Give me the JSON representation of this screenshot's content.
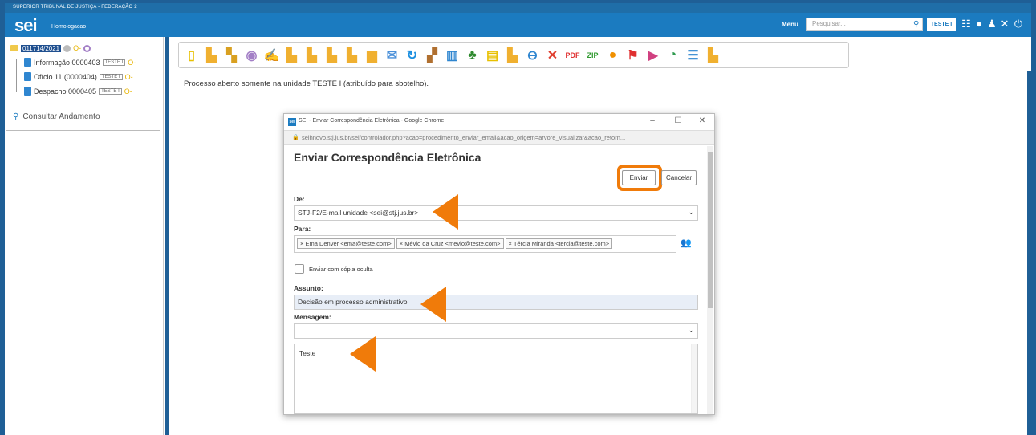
{
  "app": {
    "banner": "SUPERIOR TRIBUNAL DE JUSTIÇA - FEDERAÇÃO 2",
    "logo": "sei",
    "environment": "Homologacao",
    "menu_label": "Menu",
    "search_placeholder": "Pesquisar...",
    "unit": "TESTE I"
  },
  "tree": {
    "process_number": "011714/2021",
    "docs": [
      {
        "label": "Informação 0000403",
        "tag": "TESTE I"
      },
      {
        "label": "Ofício 11 (0000404)",
        "tag": "TESTE I"
      },
      {
        "label": "Despacho 0000405",
        "tag": "TESTE I"
      }
    ],
    "consult_label": "Consultar Andamento"
  },
  "toolbar": {
    "icons": [
      "new-document",
      "follow-process",
      "process-settings",
      "view",
      "sign",
      "send",
      "info",
      "relate",
      "attach",
      "pending",
      "email",
      "refresh",
      "sobrestar",
      "statistics",
      "region-map",
      "notes",
      "pause",
      "link",
      "remove",
      "pdf",
      "zip",
      "comment",
      "flag",
      "marker",
      "deadline",
      "list",
      "search"
    ]
  },
  "main": {
    "info_text": "Processo aberto somente na unidade TESTE I (atribuído para sbotelho)."
  },
  "popup": {
    "window_title": "SEI - Enviar Correspondência Eletrônica - Google Chrome",
    "url": "seihnovo.stj.jus.br/sei/controlador.php?acao=procedimento_enviar_email&acao_origem=arvore_visualizar&acao_retorn...",
    "form_title": "Enviar Correspondência Eletrônica",
    "send_label": "Enviar",
    "cancel_label": "Cancelar",
    "from_label": "De:",
    "from_value": "STJ-F2/E-mail unidade <sei@stj.jus.br>",
    "to_label": "Para:",
    "recipients": [
      "Ema Denver <ema@teste.com>",
      "Mévio da Cruz <mevio@teste.com>",
      "Tércia Miranda <tercia@teste.com>"
    ],
    "bcc_label": "Enviar com cópia oculta",
    "subject_label": "Assunto:",
    "subject_value": "Decisão em processo administrativo",
    "message_label": "Mensagem:",
    "message_value": "Teste"
  },
  "colors": {
    "header": "#1b7bc0",
    "highlight": "#f07b0a"
  }
}
